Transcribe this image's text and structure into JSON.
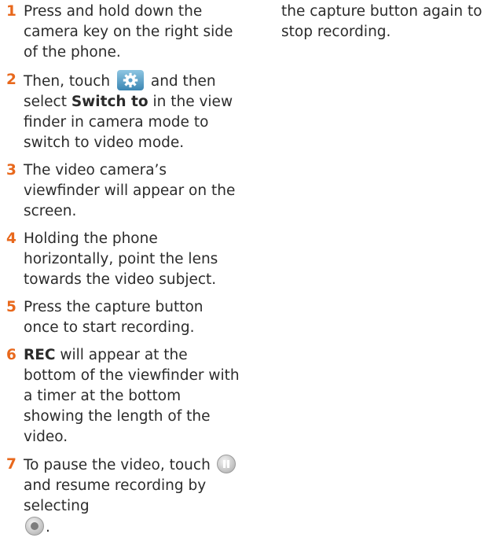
{
  "accent_color": "#e8681c",
  "steps": [
    {
      "number": "1",
      "text": "Press and hold down the camera key on the right side of the phone."
    },
    {
      "number": "2",
      "text_before_icon": "Then, touch",
      "icon": "settings-gear-icon",
      "text_after_icon": "and then select",
      "bold": "Switch to",
      "text_end": "in the view finder in camera mode to switch to video mode."
    },
    {
      "number": "3",
      "text": "The video camera’s viewfinder will appear on the screen."
    },
    {
      "number": "4",
      "text": "Holding the phone horizontally, point the lens towards the video subject."
    },
    {
      "number": "5",
      "text": "Press the capture button once to start recording."
    },
    {
      "number": "6",
      "bold": "REC",
      "text": "will appear at the bottom of the viewfinder with a timer at the bottom showing the length of the video."
    },
    {
      "number": "7",
      "text_before_icon": "To pause the video, touch",
      "icon": "pause-icon",
      "text_after_icon": "and resume recording by selecting",
      "icon2": "record-icon",
      "text_end": "."
    }
  ],
  "continuation": {
    "text": "the capture button again to stop recording."
  }
}
